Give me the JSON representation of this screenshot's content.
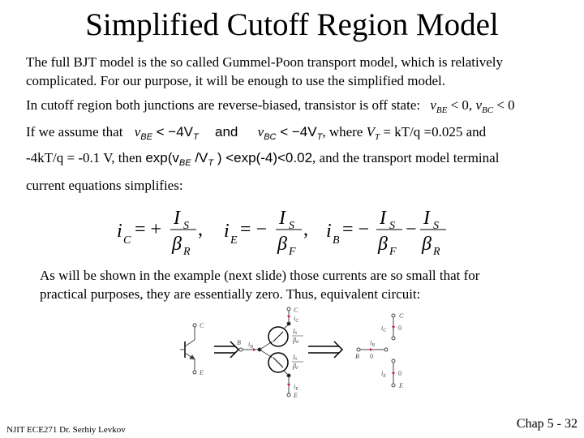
{
  "title": "Simplified Cutoff Region Model",
  "intro": {
    "line1": "The full BJT model  is the so called Gummel-Poon transport model, which is relatively",
    "line2": "complicated.  For our purpose, it will be enough to use the simplified model."
  },
  "cutoff": {
    "text": "In cutoff region both junctions are reverse-biased, transistor is off state:",
    "cond1_v": "v",
    "cond1_sub": "BE",
    "cond1_rest": " < 0, ",
    "cond2_v": "v",
    "cond2_sub": "BC",
    "cond2_rest": " < 0"
  },
  "assume": {
    "prefix": "If we assume that",
    "expr1": "v",
    "expr1_sub": "BE",
    "expr1_rest": " < −4V",
    "expr1_tsub": "T",
    "and": "and",
    "expr2": "v",
    "expr2_sub": "BC",
    "expr2_rest": " < −4V",
    "expr2_tsub": "T",
    "where": ", where ",
    "vt": "V",
    "vt_sub": "T",
    "vt_rest": " = kT/q =0.025   and"
  },
  "then": {
    "prefix": "-4kT/q = -0.1 V, then ",
    "exp": "exp(v",
    "exp_sub": "BE",
    "exp_mid": " /V",
    "exp_tsub": "T",
    "exp_rest": " ) <exp(-4)<0.02",
    "suffix": ", and the transport model terminal"
  },
  "equations_intro": "current equations simplifies:",
  "equations": {
    "ic_lhs": "i",
    "ic_sub": "C",
    "ic_op": "= +",
    "ic_num": "I",
    "ic_num_sub": "S",
    "ic_den": "β",
    "ic_den_sub": "R",
    "ie_lhs": "i",
    "ie_sub": "E",
    "ie_op": "= −",
    "ie_num": "I",
    "ie_num_sub": "S",
    "ie_den": "β",
    "ie_den_sub": "F",
    "ib_lhs": "i",
    "ib_sub": "B",
    "ib_op": "= −",
    "ib_num1": "I",
    "ib_num1_sub": "S",
    "ib_den1": "β",
    "ib_den1_sub": "F",
    "ib_minus": "−",
    "ib_num2": "I",
    "ib_num2_sub": "S",
    "ib_den2": "β",
    "ib_den2_sub": "R",
    "comma": ","
  },
  "conclusion": {
    "line1": "As will be shown in the example (next slide) those currents are so small that for",
    "line2": "practical purposes, they are essentially zero. Thus, equivalent circuit:"
  },
  "circuit": {
    "label_C": "C",
    "label_E": "E",
    "label_B": "B",
    "label_iC": "i",
    "label_iC_sub": "C",
    "label_iE": "i",
    "label_iE_sub": "E",
    "label_iB": "i",
    "label_iB_sub": "B",
    "src_top_num": "I",
    "src_top_num_sub": "S",
    "src_top_den": "β",
    "src_top_den_sub": "R",
    "src_bot_num": "I",
    "src_bot_num_sub": "S",
    "src_bot_den": "β",
    "src_bot_den_sub": "F",
    "zero": "0",
    "current_arrow_color": "#c0206a",
    "line_color": "#444444"
  },
  "footer": {
    "left": "NJIT  ECE271  Dr. Serhiy Levkov",
    "right": "Chap 5 - 32"
  }
}
